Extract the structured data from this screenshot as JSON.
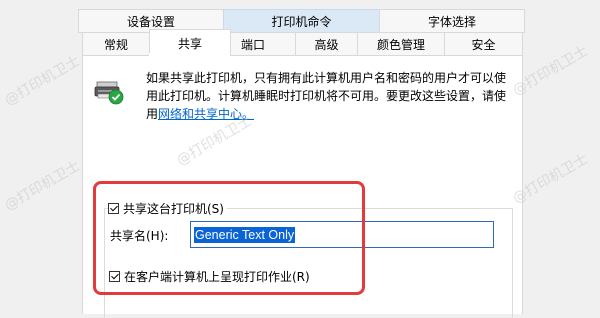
{
  "tabs_row1": [
    {
      "label": "设备设置"
    },
    {
      "label": "打印机命令"
    },
    {
      "label": "字体选择"
    }
  ],
  "tabs_row2": [
    {
      "label": "常规"
    },
    {
      "label": "共享"
    },
    {
      "label": "端口"
    },
    {
      "label": "高级"
    },
    {
      "label": "颜色管理"
    },
    {
      "label": "安全"
    }
  ],
  "description": {
    "line1": "如果共享此打印机，只有拥有此计算机用户名和密码的用户才可以使",
    "line2": "用此打印机。计算机睡眠时打印机将不可用。要更改这些设置，请使",
    "line3_prefix": "用",
    "link": "网络和共享中心。"
  },
  "share_checkbox": {
    "label": "共享这台打印机(S)",
    "checked": true
  },
  "share_name": {
    "label": "共享名(H):",
    "value": "Generic  Text Only"
  },
  "render_jobs_checkbox": {
    "label": "在客户端计算机上呈现打印作业(R)",
    "checked": true
  },
  "watermark": "@打印机卫士",
  "colors": {
    "accent": "#0a64d6",
    "highlight": "#e23b3b",
    "link": "#0066cc"
  }
}
